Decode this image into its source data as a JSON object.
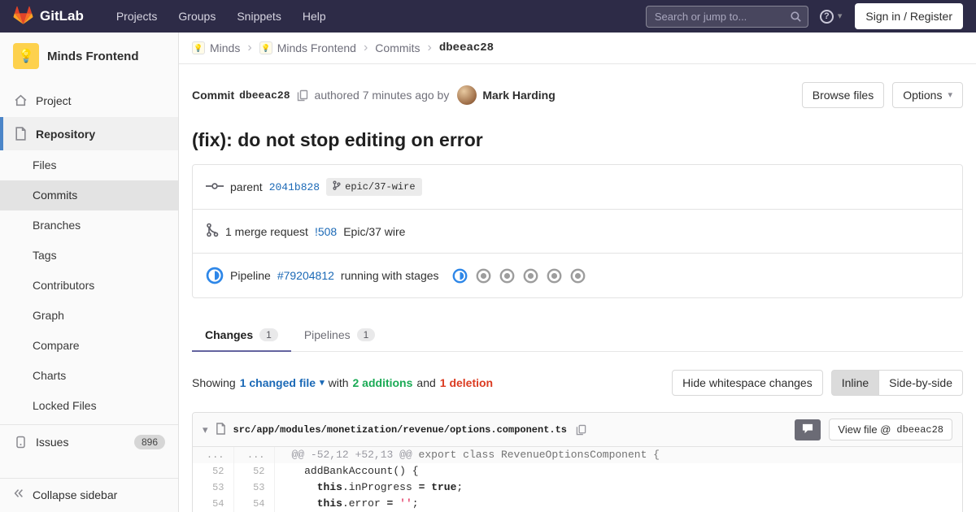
{
  "navbar": {
    "brand": "GitLab",
    "items": [
      "Projects",
      "Groups",
      "Snippets",
      "Help"
    ],
    "search_placeholder": "Search or jump to...",
    "sign_in_label": "Sign in / Register"
  },
  "sidebar": {
    "project_name": "Minds Frontend",
    "project_item": "Project",
    "repository_item": "Repository",
    "repo_subitems": [
      "Files",
      "Commits",
      "Branches",
      "Tags",
      "Contributors",
      "Graph",
      "Compare",
      "Charts",
      "Locked Files"
    ],
    "active_subitem": "Commits",
    "issues_label": "Issues",
    "issues_count": "896",
    "collapse_label": "Collapse sidebar"
  },
  "breadcrumb": {
    "group": "Minds",
    "project": "Minds Frontend",
    "section": "Commits",
    "sha": "dbeeac28"
  },
  "commit": {
    "label": "Commit",
    "sha": "dbeeac28",
    "authored_text": "authored 7 minutes ago by",
    "author": "Mark Harding",
    "browse_files_label": "Browse files",
    "options_label": "Options",
    "title": "(fix): do not stop editing on error",
    "parent_label": "parent",
    "parent_sha": "2041b828",
    "branch_label": "epic/37-wire",
    "mr_count_text": "1 merge request",
    "mr_ref": "!508",
    "mr_title": "Epic/37 wire",
    "pipeline_label": "Pipeline",
    "pipeline_id": "#79204812",
    "pipeline_status_text": "running with stages",
    "pipeline_stages": [
      "running",
      "created",
      "created",
      "created",
      "created",
      "created"
    ]
  },
  "tabs": [
    {
      "label": "Changes",
      "count": "1",
      "active": true
    },
    {
      "label": "Pipelines",
      "count": "1",
      "active": false
    }
  ],
  "summary": {
    "showing": "Showing",
    "changed_files": "1 changed file",
    "with_text": "with",
    "additions": "2 additions",
    "and_text": "and",
    "deletions": "1 deletion",
    "hide_whitespace_label": "Hide whitespace changes",
    "inline_label": "Inline",
    "side_by_side_label": "Side-by-side"
  },
  "diff": {
    "file_path": "src/app/modules/monetization/revenue/options.component.ts",
    "view_file_label": "View file @",
    "view_file_sha": "dbeeac28",
    "hunk_ellipsis": "...",
    "hunk_marker": "@@ -52,12 +52,13 @@",
    "hunk_context": " export class RevenueOptionsComponent {",
    "lines": [
      {
        "old": "52",
        "new": "52",
        "tokens": [
          [
            "plain",
            "  addBankAccount() {"
          ]
        ]
      },
      {
        "old": "53",
        "new": "53",
        "tokens": [
          [
            "plain",
            "    "
          ],
          [
            "kw",
            "this"
          ],
          [
            "plain",
            ".inProgress "
          ],
          [
            "op",
            "="
          ],
          [
            "plain",
            " "
          ],
          [
            "kw",
            "true"
          ],
          [
            "plain",
            ";"
          ]
        ]
      },
      {
        "old": "54",
        "new": "54",
        "tokens": [
          [
            "plain",
            "    "
          ],
          [
            "kw",
            "this"
          ],
          [
            "plain",
            ".error "
          ],
          [
            "op",
            "="
          ],
          [
            "plain",
            " "
          ],
          [
            "str",
            "''"
          ],
          [
            "plain",
            ";"
          ]
        ]
      }
    ]
  },
  "colors": {
    "navbar_bg": "#2d2b47",
    "brand_orange": "#fc6d26",
    "link_blue": "#1b69b6",
    "additions_green": "#1aaa55",
    "deletions_red": "#db3b21",
    "pipeline_running_blue": "#2e87e8",
    "active_indicator_blue": "#4b85c8",
    "tab_active_indigo": "#63639f"
  }
}
